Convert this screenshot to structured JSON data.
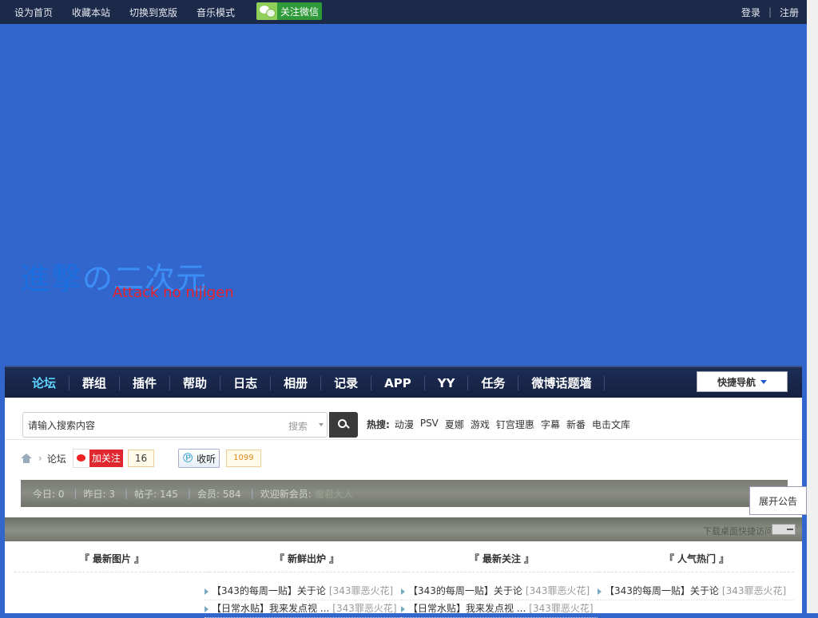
{
  "topbar": {
    "links": [
      "设为首页",
      "收藏本站",
      "切换到宽版",
      "音乐模式"
    ],
    "wechat": "关注微信",
    "login": "登录",
    "sep": "|",
    "register": "注册"
  },
  "logo": {
    "jp_main": "進撃",
    "jp_rest": "の二次元",
    "en": "Attack no nijigen"
  },
  "nav": {
    "items": [
      "论坛",
      "群组",
      "插件",
      "帮助",
      "日志",
      "相册",
      "记录",
      "APP",
      "YY",
      "任务",
      "微博话题墙"
    ],
    "quick": "快捷导航"
  },
  "search": {
    "placeholder": "请输入搜索内容",
    "type": "搜索",
    "hot_label": "热搜:",
    "hot": [
      "动漫",
      "PSV",
      "夏娜",
      "游戏",
      "钉宫理惠",
      "字幕",
      "新番",
      "电击文库"
    ]
  },
  "crumb": {
    "forum": "论坛",
    "weibo_label": "加关注",
    "weibo_count": "16",
    "tqq_label": "收听",
    "tqq_count": "1099"
  },
  "stats": {
    "today": "今日: 0",
    "yesterday": "昨日: 3",
    "posts": "帖子: 145",
    "members": "会员: 584",
    "welcome": "欢迎新会员:",
    "new_member": "魔君大人"
  },
  "notice": "展开公告",
  "download": "下载桌面快捷访问",
  "columns": [
    "『 最新图片 』",
    "『 新鲜出炉 』",
    "『 最新关注 』",
    "『 人气热门 』"
  ],
  "lists": [
    [
      {
        "title": "【343的每周一贴】关于论",
        "by": "[343罪恶火花]"
      },
      {
        "title": "【日常水贴】我来发点视 ...",
        "by": "[343罪恶火花]"
      }
    ],
    [
      {
        "title": "【343的每周一贴】关于论",
        "by": "[343罪恶火花]"
      },
      {
        "title": "【日常水贴】我来发点视 ...",
        "by": "[343罪恶火花]"
      }
    ],
    [
      {
        "title": "【343的每周一贴】关于论",
        "by": "[343罪恶火花]"
      }
    ]
  ]
}
